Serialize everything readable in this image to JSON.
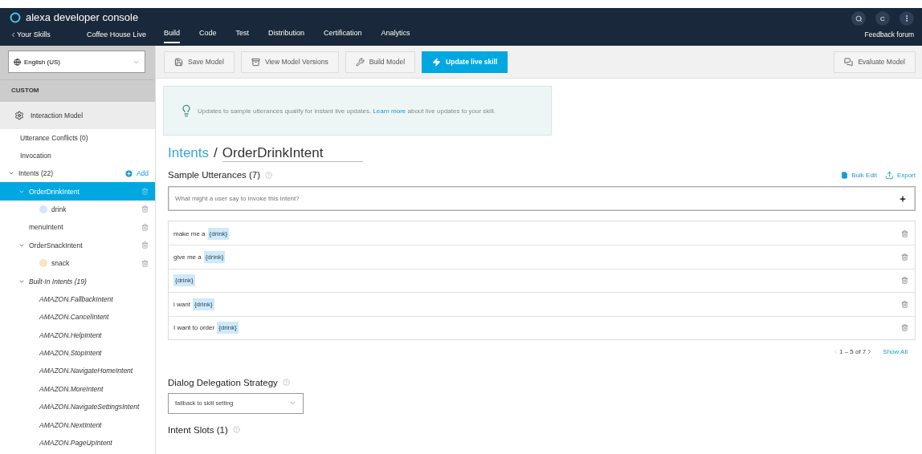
{
  "header": {
    "title": "alexa developer console",
    "back_link": "Your Skills",
    "skill_name": "Coffee House Live",
    "tabs": [
      {
        "label": "Build",
        "selected": true
      },
      {
        "label": "Code",
        "selected": false
      },
      {
        "label": "Test",
        "selected": false
      },
      {
        "label": "Distribution",
        "selected": false
      },
      {
        "label": "Certification",
        "selected": false
      },
      {
        "label": "Analytics",
        "selected": false
      }
    ],
    "avatar": "C",
    "feedback_link": "Feedback forum"
  },
  "sidebar": {
    "language": "English (US)",
    "section": "CUSTOM",
    "model_item": "Interaction Model",
    "items": [
      {
        "label": "Utterance Conflicts (0)"
      },
      {
        "label": "Invocation"
      }
    ],
    "tree": [
      {
        "kind": "group",
        "label": "Intents (22)",
        "add_label": "Add",
        "expanded": true,
        "children": [
          {
            "kind": "intent",
            "label": "OrderDrinkIntent",
            "selected": true,
            "expanded": true,
            "children": [
              {
                "kind": "slot",
                "label": "drink",
                "color": "#cfe8fb",
                "selected": false
              }
            ]
          },
          {
            "kind": "intent",
            "label": "menuIntent",
            "selected": false
          },
          {
            "kind": "intent",
            "label": "OrderSnackIntent",
            "selected": false,
            "expanded": true,
            "children": [
              {
                "kind": "slot",
                "label": "snack",
                "color": "#fde3c4",
                "selected": false
              }
            ]
          },
          {
            "kind": "builtin-group",
            "label": "Built-In Intents (19)",
            "selected": false,
            "expanded": true,
            "children": [
              {
                "kind": "builtin",
                "label": "AMAZON.FallbackIntent",
                "selected": false
              },
              {
                "kind": "builtin",
                "label": "AMAZON.CancelIntent",
                "selected": false
              },
              {
                "kind": "builtin",
                "label": "AMAZON.HelpIntent",
                "selected": false
              },
              {
                "kind": "builtin",
                "label": "AMAZON.StopIntent",
                "selected": false
              },
              {
                "kind": "builtin",
                "label": "AMAZON.NavigateHomeIntent",
                "selected": false
              },
              {
                "kind": "builtin",
                "label": "AMAZON.MoreIntent",
                "selected": false
              },
              {
                "kind": "builtin",
                "label": "AMAZON.NavigateSettingsIntent",
                "selected": false
              },
              {
                "kind": "builtin",
                "label": "AMAZON.NextIntent",
                "selected": false
              },
              {
                "kind": "builtin",
                "label": "AMAZON.PageUpIntent",
                "selected": false
              }
            ]
          }
        ]
      }
    ]
  },
  "toolbar": {
    "buttons": [
      {
        "kind": "save",
        "label": "Save Model",
        "primary": false
      },
      {
        "kind": "versions",
        "label": "View Model Versions",
        "primary": false
      },
      {
        "kind": "build",
        "label": "Build Model",
        "primary": false
      },
      {
        "kind": "update",
        "label": "Update live skill",
        "primary": true
      }
    ],
    "right_button": {
      "kind": "evaluate",
      "label": "Evaluate Model",
      "primary": false
    }
  },
  "notice": {
    "before": "Updates to sample utterances qualify for instant live updates.",
    "link": "Learn more",
    "after": "about live updates to your skill."
  },
  "breadcrumb": {
    "parent": "Intents",
    "separator": "/",
    "current": "OrderDrinkIntent"
  },
  "utterances": {
    "title": "Sample Utterances (7)",
    "bulk_edit": "Bulk Edit",
    "export": "Export",
    "placeholder": "What might a user say to invoke this intent?",
    "rows": [
      {
        "text": "make me a",
        "slot": "{drink}"
      },
      {
        "text": "give me a",
        "slot": "{drink}"
      },
      {
        "slot": "{drink}"
      },
      {
        "text": "i want",
        "slot": "{drink}"
      },
      {
        "text": "I want to order",
        "slot": "{drink}"
      }
    ],
    "pager": "1 – 5 of 7",
    "show_all": "Show All"
  },
  "delegation": {
    "title": "Dialog Delegation Strategy",
    "value": "fallback to skill setting"
  },
  "slots": {
    "title": "Intent Slots (1)"
  }
}
